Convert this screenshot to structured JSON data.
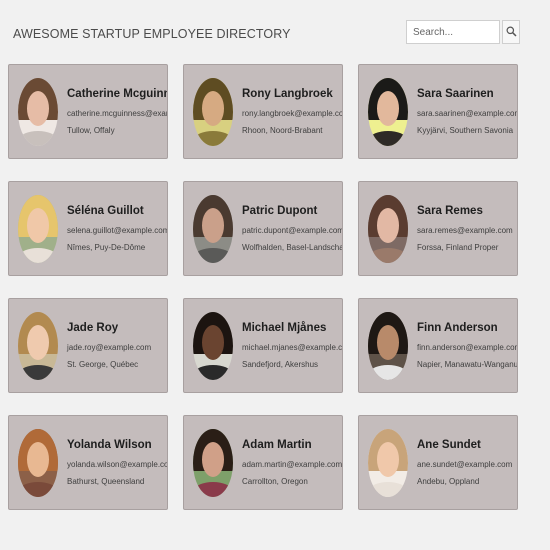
{
  "header": {
    "title": "AWESOME STARTUP EMPLOYEE DIRECTORY",
    "search_placeholder": "Search...",
    "search_icon": "magnifier-icon"
  },
  "employees": [
    {
      "name": "Catherine Mcguinness",
      "email": "catherine.mcguinness@example.com",
      "location": "Tullow, Offaly",
      "avatar": {
        "bg": "#efe8e4",
        "hair": "#6a4a34",
        "skin": "#e6bca6",
        "shirt": "#c8c0bc"
      }
    },
    {
      "name": "Rony Langbroek",
      "email": "rony.langbroek@example.com",
      "location": "Rhoon, Noord-Brabant",
      "avatar": {
        "bg": "#d8d080",
        "hair": "#5e4c22",
        "skin": "#d6aa82",
        "shirt": "#8a7a3a"
      }
    },
    {
      "name": "Sara Saarinen",
      "email": "sara.saarinen@example.com",
      "location": "Kyyjärvi, Southern Savonia",
      "avatar": {
        "bg": "#eef090",
        "hair": "#1b1a18",
        "skin": "#e2b89c",
        "shirt": "#2e2a26"
      }
    },
    {
      "name": "Séléna Guillot",
      "email": "selena.guillot@example.com",
      "location": "Nîmes, Puy-De-Dôme",
      "avatar": {
        "bg": "#a0b08a",
        "hair": "#e6c56c",
        "skin": "#f0c8a8",
        "shirt": "#e8e0d8"
      }
    },
    {
      "name": "Patric Dupont",
      "email": "patric.dupont@example.com",
      "location": "Wolfhalden, Basel-Landschaft",
      "avatar": {
        "bg": "#8c8c86",
        "hair": "#4a3a30",
        "skin": "#caa08a",
        "shirt": "#5a5a58"
      }
    },
    {
      "name": "Sara Remes",
      "email": "sara.remes@example.com",
      "location": "Forssa, Finland Proper",
      "avatar": {
        "bg": "#7e6a64",
        "hair": "#5a3c30",
        "skin": "#e2b8a4",
        "shirt": "#9a7a6a"
      }
    },
    {
      "name": "Jade Roy",
      "email": "jade.roy@example.com",
      "location": "St. George, Québec",
      "avatar": {
        "bg": "#c8b896",
        "hair": "#b28a50",
        "skin": "#efcaae",
        "shirt": "#3a3a3a"
      }
    },
    {
      "name": "Michael Mjånes",
      "email": "michael.mjanes@example.com",
      "location": "Sandefjord, Akershus",
      "avatar": {
        "bg": "#d8d8d0",
        "hair": "#1c1410",
        "skin": "#6a4430",
        "shirt": "#2a2a2a"
      }
    },
    {
      "name": "Finn Anderson",
      "email": "finn.anderson@example.com",
      "location": "Napier, Manawatu-Wanganui",
      "avatar": {
        "bg": "#5e5248",
        "hair": "#1e1814",
        "skin": "#b88a6a",
        "shirt": "#e6e6e6"
      }
    },
    {
      "name": "Yolanda Wilson",
      "email": "yolanda.wilson@example.com",
      "location": "Bathurst, Queensland",
      "avatar": {
        "bg": "#8c6048",
        "hair": "#b06a38",
        "skin": "#e8b892",
        "shirt": "#7a4a3a"
      }
    },
    {
      "name": "Adam Martin",
      "email": "adam.martin@example.com",
      "location": "Carrollton, Oregon",
      "avatar": {
        "bg": "#7ea06a",
        "hair": "#2a1e16",
        "skin": "#d0a088",
        "shirt": "#8a3a4a"
      }
    },
    {
      "name": "Ane Sundet",
      "email": "ane.sundet@example.com",
      "location": "Andebu, Oppland",
      "avatar": {
        "bg": "#f2ece6",
        "hair": "#c8a47a",
        "skin": "#f0c8aa",
        "shirt": "#e8e0d8"
      }
    }
  ]
}
